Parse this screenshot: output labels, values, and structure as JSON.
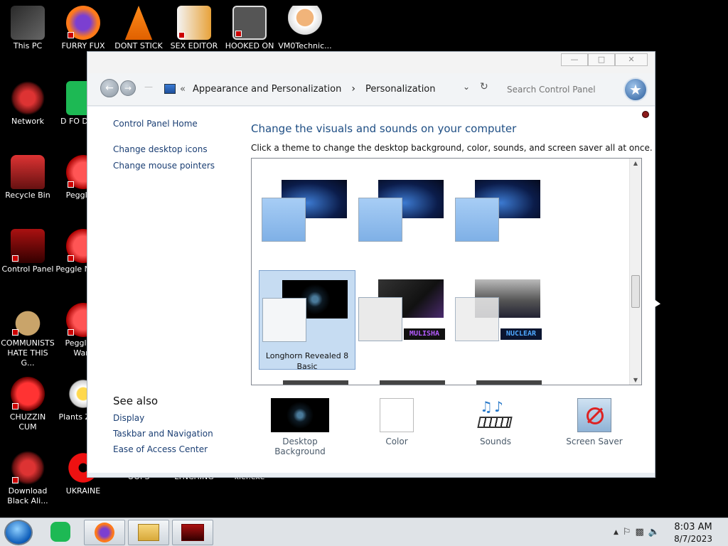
{
  "desktop": {
    "icons": [
      {
        "label": "This PC"
      },
      {
        "label": "FURRY FUX"
      },
      {
        "label": "DONT STICK"
      },
      {
        "label": "SEX EDITOR"
      },
      {
        "label": "HOOKED ON"
      },
      {
        "label": "VM0Technic..."
      },
      {
        "label": "Network"
      },
      {
        "label": "D FO DUMB"
      },
      {
        "label": "Recycle Bin"
      },
      {
        "label": "Peggle D"
      },
      {
        "label": "Control Panel"
      },
      {
        "label": "Peggle N Delu"
      },
      {
        "label": "COMMUNISTS HATE THIS G..."
      },
      {
        "label": "Peggle of Warc"
      },
      {
        "label": "CHUZZIN CUM"
      },
      {
        "label": "Plants Zomb"
      },
      {
        "label": "Download Black Ali..."
      },
      {
        "label": "UKRAINE"
      },
      {
        "label": "OOPS"
      },
      {
        "label": "LYNCHING"
      },
      {
        "label": "kier.exe"
      }
    ]
  },
  "window": {
    "breadcrumb": {
      "overflow": "«",
      "items": [
        "Appearance and Personalization",
        "Personalization"
      ],
      "separator": "›"
    },
    "search": {
      "placeholder": "Search Control Panel"
    },
    "left_pane": {
      "home": "Control Panel Home",
      "links": [
        "Change desktop icons",
        "Change mouse pointers"
      ]
    },
    "title": "Change the visuals and sounds on your computer",
    "subtitle": "Click a theme to change the desktop background, color, sounds, and screen saver all at once.",
    "themes_row2": [
      {
        "label": "Longhorn Revealed 8 Basic",
        "badge": ""
      },
      {
        "label": "",
        "badge": "MULISHA"
      },
      {
        "label": "",
        "badge": "NUCLEAR"
      }
    ],
    "see_also": {
      "heading": "See also",
      "links": [
        "Display",
        "Taskbar and Navigation",
        "Ease of Access Center"
      ]
    },
    "bottom_items": [
      {
        "label": "Desktop Background",
        "icon": "desktop-background-icon"
      },
      {
        "label": "Color",
        "icon": "color-icon"
      },
      {
        "label": "Sounds",
        "icon": "sounds-icon"
      },
      {
        "label": "Screen Saver",
        "icon": "screen-saver-icon"
      }
    ]
  },
  "taskbar": {
    "clock": {
      "time": "8:03 AM",
      "date": "8/7/2023"
    }
  }
}
